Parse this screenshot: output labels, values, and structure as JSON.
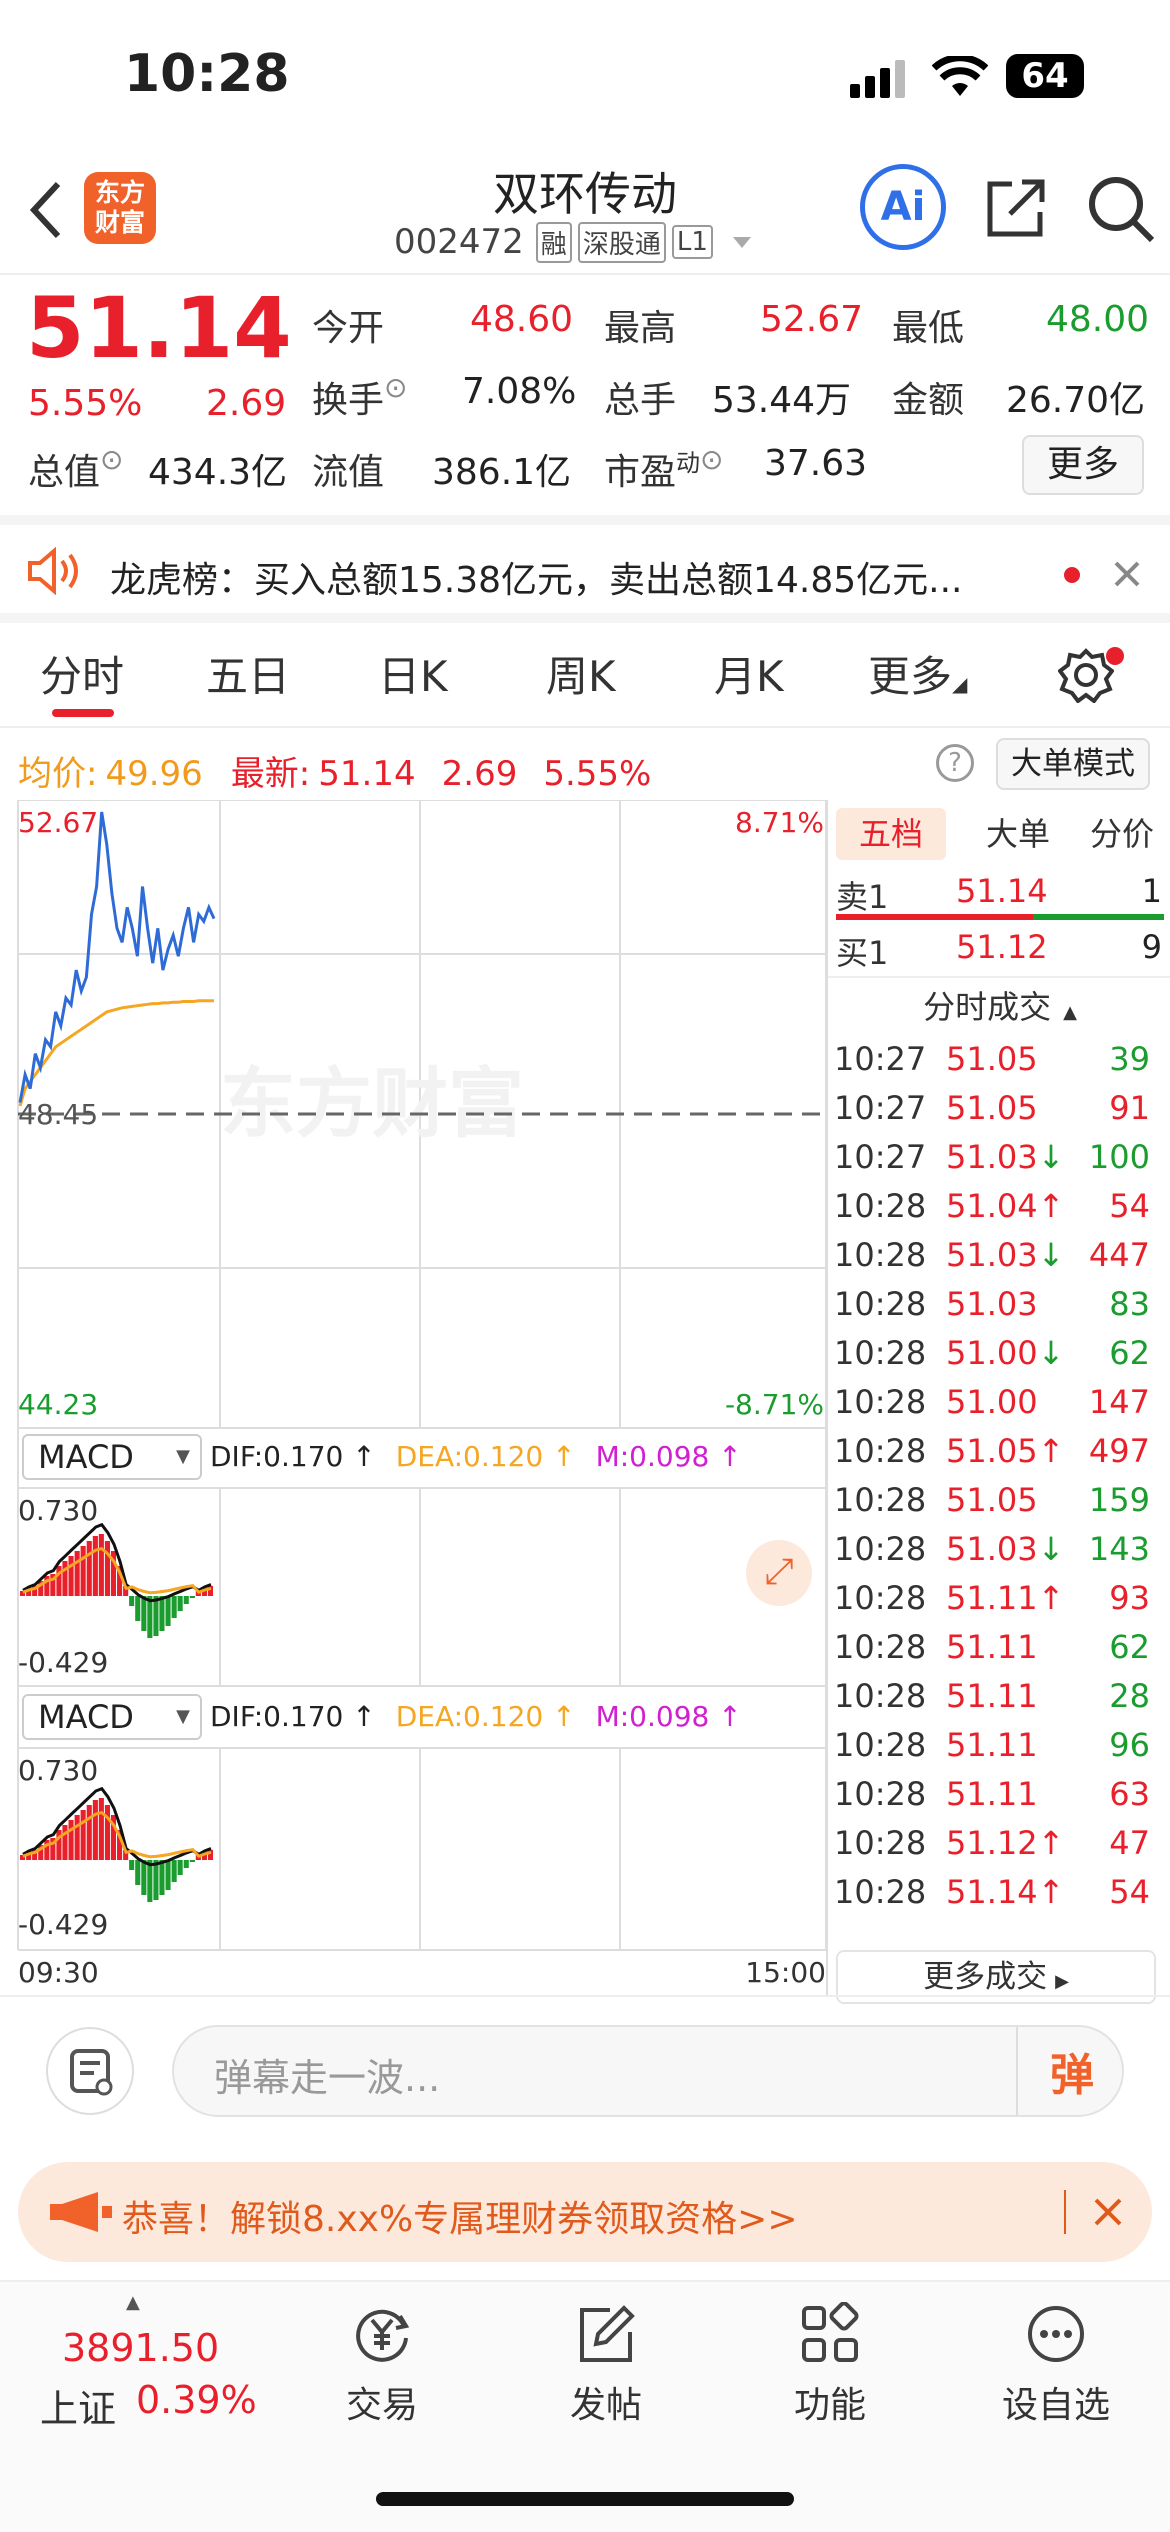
{
  "status": {
    "time": "10:28",
    "battery": "64"
  },
  "header": {
    "logo": "东方\n财富",
    "logo_line1": "东方",
    "logo_line2": "财富",
    "stock_name": "双环传动",
    "stock_code": "002472",
    "tags": [
      "融",
      "深股通",
      "L1"
    ],
    "ai": "Ai"
  },
  "quote": {
    "price": "51.14",
    "change_pct": "5.55%",
    "change": "2.69",
    "open_label": "今开",
    "open": "48.60",
    "high_label": "最高",
    "high": "52.67",
    "low_label": "最低",
    "low": "48.00",
    "turnover_label": "换手",
    "turnover": "7.08%",
    "volume_label": "总手",
    "volume": "53.44万",
    "amount_label": "金额",
    "amount": "26.70亿",
    "mktcap_label": "总值",
    "mktcap": "434.3亿",
    "float_label": "流值",
    "float": "386.1亿",
    "pe_label": "市盈",
    "pe_sup": "动",
    "pe": "37.63",
    "more": "更多"
  },
  "banner": {
    "text": "龙虎榜：买入总额15.38亿元，卖出总额14.85亿元..."
  },
  "tabs": [
    "分时",
    "五日",
    "日K",
    "周K",
    "月K",
    "更多"
  ],
  "infobar": {
    "avg_label": "均价:",
    "avg": "49.96",
    "latest_label": "最新:",
    "latest": "51.14",
    "chg": "2.69",
    "pct": "5.55%",
    "mode": "大单模式"
  },
  "chart_axes": {
    "top_price": "52.67",
    "base_price": "48.45",
    "bottom_price": "44.23",
    "top_pct": "8.71%",
    "bottom_pct": "-8.71%",
    "time_start": "09:30",
    "time_end": "15:00",
    "watermark": "东方财富"
  },
  "macd": {
    "label": "MACD",
    "dif": "DIF:0.170 ↑",
    "dea": "DEA:0.120 ↑",
    "m": "M:0.098 ↑",
    "top": "0.730",
    "bottom": "-0.429"
  },
  "orderbook": {
    "tabs": [
      "五档",
      "大单",
      "分价"
    ],
    "sell1": {
      "label": "卖1",
      "price": "51.14",
      "vol": "1"
    },
    "buy1": {
      "label": "买1",
      "price": "51.12",
      "vol": "9"
    },
    "trades_title": "分时成交",
    "trades": [
      {
        "t": "10:27",
        "p": "51.05",
        "d": "",
        "v": "39",
        "vc": "g"
      },
      {
        "t": "10:27",
        "p": "51.05",
        "d": "",
        "v": "91",
        "vc": "r"
      },
      {
        "t": "10:27",
        "p": "51.03",
        "d": "↓",
        "v": "100",
        "vc": "g"
      },
      {
        "t": "10:28",
        "p": "51.04",
        "d": "↑",
        "v": "54",
        "vc": "r"
      },
      {
        "t": "10:28",
        "p": "51.03",
        "d": "↓",
        "v": "447",
        "vc": "r"
      },
      {
        "t": "10:28",
        "p": "51.03",
        "d": "",
        "v": "83",
        "vc": "g"
      },
      {
        "t": "10:28",
        "p": "51.00",
        "d": "↓",
        "v": "62",
        "vc": "g"
      },
      {
        "t": "10:28",
        "p": "51.00",
        "d": "",
        "v": "147",
        "vc": "r"
      },
      {
        "t": "10:28",
        "p": "51.05",
        "d": "↑",
        "v": "497",
        "vc": "r"
      },
      {
        "t": "10:28",
        "p": "51.05",
        "d": "",
        "v": "159",
        "vc": "g"
      },
      {
        "t": "10:28",
        "p": "51.03",
        "d": "↓",
        "v": "143",
        "vc": "g"
      },
      {
        "t": "10:28",
        "p": "51.11",
        "d": "↑",
        "v": "93",
        "vc": "r"
      },
      {
        "t": "10:28",
        "p": "51.11",
        "d": "",
        "v": "62",
        "vc": "g"
      },
      {
        "t": "10:28",
        "p": "51.11",
        "d": "",
        "v": "28",
        "vc": "g"
      },
      {
        "t": "10:28",
        "p": "51.11",
        "d": "",
        "v": "96",
        "vc": "g"
      },
      {
        "t": "10:28",
        "p": "51.11",
        "d": "",
        "v": "63",
        "vc": "r"
      },
      {
        "t": "10:28",
        "p": "51.12",
        "d": "↑",
        "v": "47",
        "vc": "r"
      },
      {
        "t": "10:28",
        "p": "51.14",
        "d": "↑",
        "v": "54",
        "vc": "r"
      }
    ],
    "more_trades": "更多成交"
  },
  "comment": {
    "placeholder": "弹幕走一波...",
    "danmu": "弹"
  },
  "promo": {
    "text": "恭喜！解锁8.xx%专属理财券领取资格>>"
  },
  "bottomnav": {
    "index_value": "3891.50",
    "index_name": "上证",
    "index_pct": "0.39%",
    "items": [
      "交易",
      "发帖",
      "功能",
      "设自选"
    ]
  },
  "chart_data": {
    "type": "line",
    "series": [
      {
        "values": [
          48.5,
          48.9,
          48.7,
          49.2,
          49.0,
          49.4,
          49.3,
          49.8,
          49.6,
          50.0,
          49.9,
          50.4,
          50.1,
          50.3,
          51.2,
          51.6,
          52.67,
          52.2,
          51.5,
          51.0,
          50.8,
          51.3,
          51.0,
          50.6,
          51.6,
          51.0,
          50.5,
          51.0,
          50.4,
          50.7,
          50.9,
          50.6,
          51.0,
          51.3,
          50.8,
          51.2,
          51.1,
          51.3,
          51.14
        ]
      },
      {
        "values": [
          48.45,
          48.7,
          48.8,
          48.9,
          49.0,
          49.1,
          49.2,
          49.3,
          49.35,
          49.4,
          49.45,
          49.5,
          49.55,
          49.6,
          49.65,
          49.7,
          49.75,
          49.8,
          49.82,
          49.84,
          49.86,
          49.87,
          49.88,
          49.89,
          49.9,
          49.91,
          49.92,
          49.92,
          49.93,
          49.93,
          49.94,
          49.94,
          49.95,
          49.95,
          49.95,
          49.96,
          49.96,
          49.96,
          49.96
        ]
      }
    ],
    "ylim": [
      44.23,
      52.67
    ],
    "macd_bars": [
      0.05,
      0.08,
      0.1,
      0.15,
      0.2,
      0.22,
      0.3,
      0.35,
      0.4,
      0.45,
      0.5,
      0.55,
      0.6,
      0.62,
      0.55,
      0.45,
      0.3,
      0.1,
      -0.1,
      -0.25,
      -0.35,
      -0.42,
      -0.4,
      -0.35,
      -0.3,
      -0.22,
      -0.15,
      -0.08,
      -0.02,
      0.05,
      0.08,
      0.1
    ]
  }
}
